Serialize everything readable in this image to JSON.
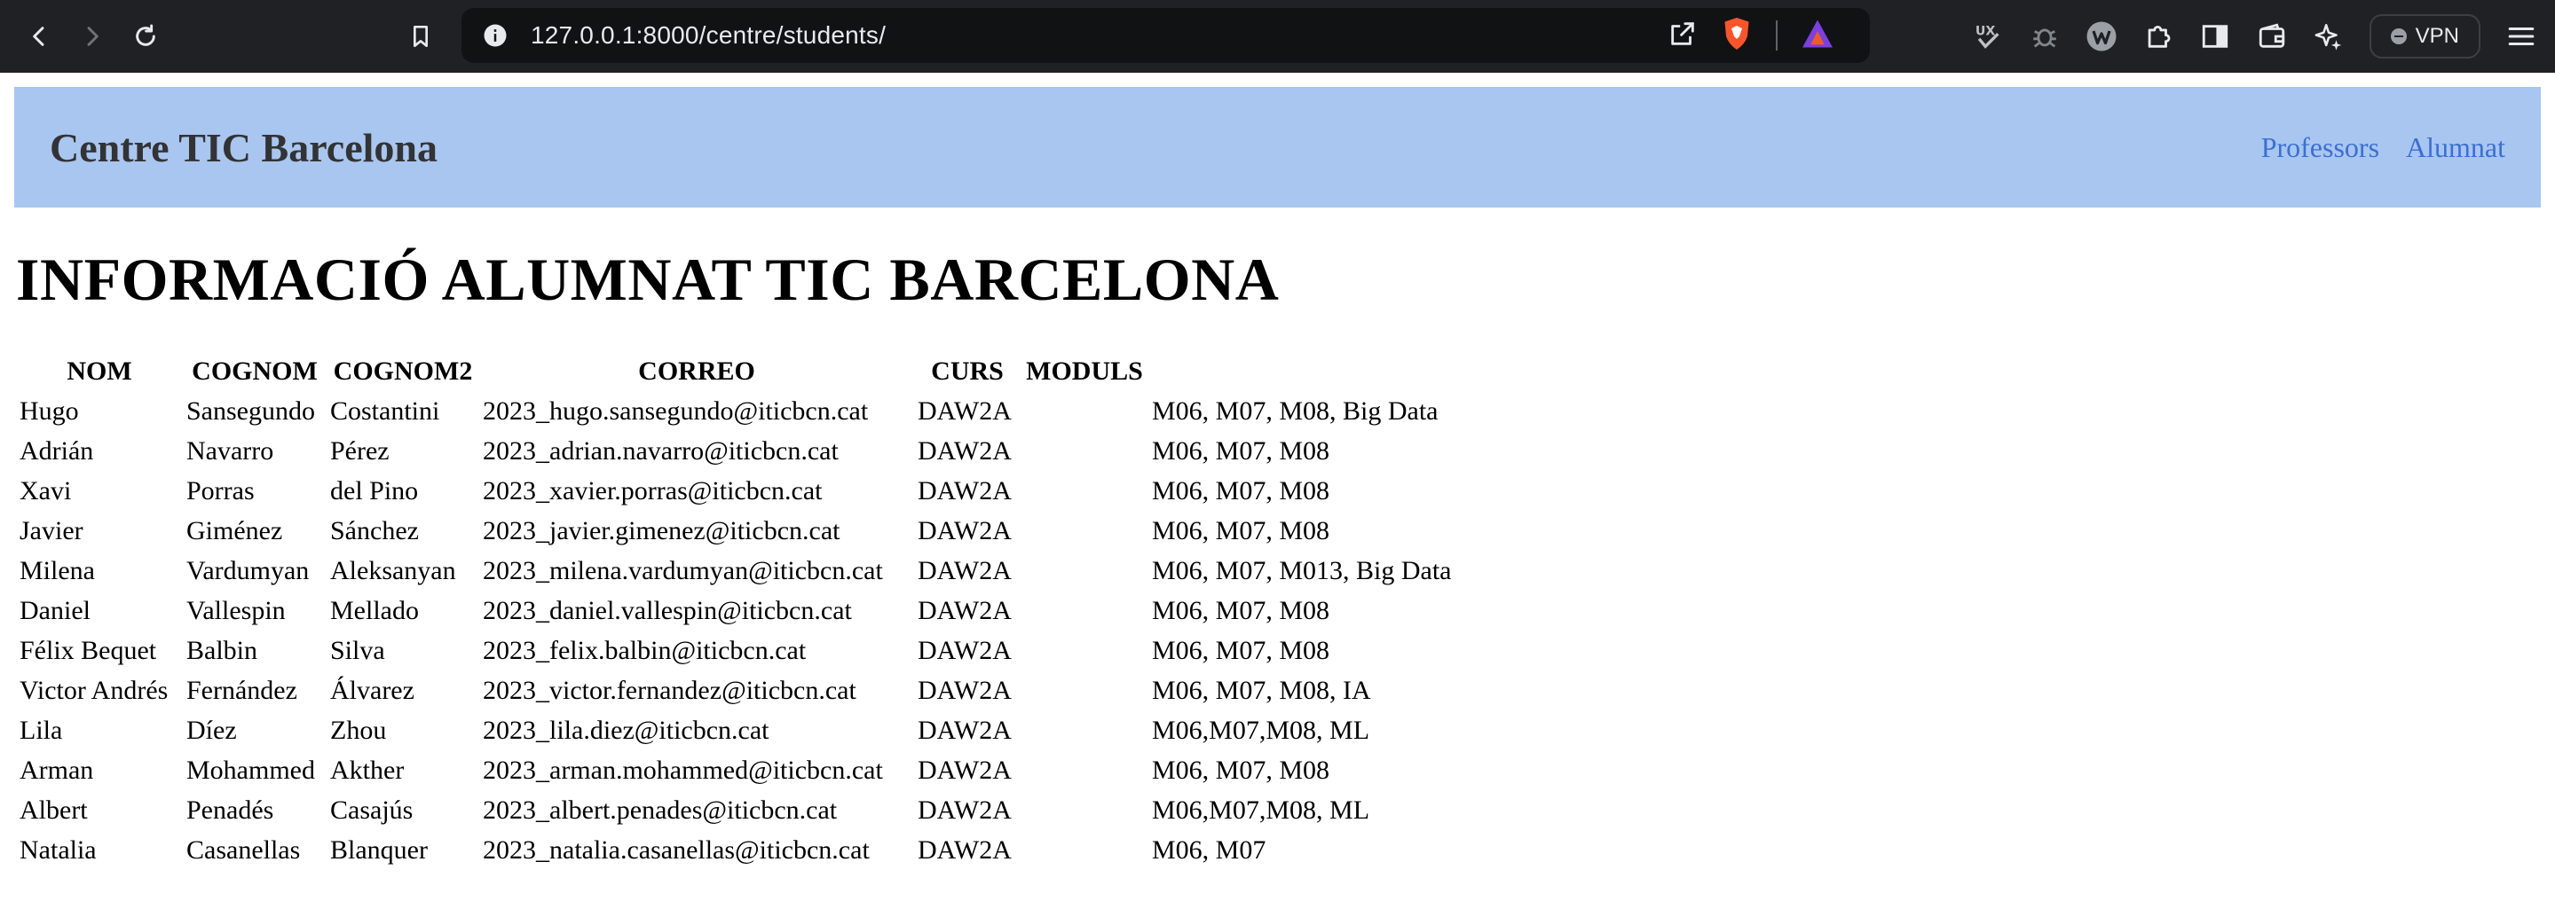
{
  "browser": {
    "url": "127.0.0.1:8000/centre/students/",
    "vpn_label": "VPN"
  },
  "header": {
    "title": "Centre TIC Barcelona",
    "nav": [
      "Professors",
      "Alumnat"
    ]
  },
  "page": {
    "heading": "INFORMACIÓ ALUMNAT TIC BARCELONA"
  },
  "table": {
    "columns": [
      "NOM",
      "COGNOM",
      "COGNOM2",
      "CORREO",
      "CURS",
      "MODULS"
    ],
    "rows": [
      [
        "Hugo",
        "Sansegundo",
        "Costantini",
        "2023_hugo.sansegundo@iticbcn.cat",
        "DAW2A",
        "M06, M07, M08, Big Data"
      ],
      [
        "Adrián",
        "Navarro",
        "Pérez",
        "2023_adrian.navarro@iticbcn.cat",
        "DAW2A",
        "M06, M07, M08"
      ],
      [
        "Xavi",
        "Porras",
        "del Pino",
        "2023_xavier.porras@iticbcn.cat",
        "DAW2A",
        "M06, M07, M08"
      ],
      [
        "Javier",
        "Giménez",
        "Sánchez",
        "2023_javier.gimenez@iticbcn.cat",
        "DAW2A",
        "M06, M07, M08"
      ],
      [
        "Milena",
        "Vardumyan",
        "Aleksanyan",
        "2023_milena.vardumyan@iticbcn.cat",
        "DAW2A",
        "M06, M07, M013, Big Data"
      ],
      [
        "Daniel",
        "Vallespin",
        "Mellado",
        "2023_daniel.vallespin@iticbcn.cat",
        "DAW2A",
        "M06, M07, M08"
      ],
      [
        "Félix Bequet",
        "Balbin",
        "Silva",
        "2023_felix.balbin@iticbcn.cat",
        "DAW2A",
        "M06, M07, M08"
      ],
      [
        "Victor Andrés",
        "Fernández",
        "Álvarez",
        "2023_victor.fernandez@iticbcn.cat",
        "DAW2A",
        "M06, M07, M08, IA"
      ],
      [
        "Lila",
        "Díez",
        "Zhou",
        "2023_lila.diez@iticbcn.cat",
        "DAW2A",
        "M06,M07,M08, ML"
      ],
      [
        "Arman",
        "Mohammed",
        "Akther",
        "2023_arman.mohammed@iticbcn.cat",
        "DAW2A",
        "M06, M07, M08"
      ],
      [
        "Albert",
        "Penadés",
        "Casajús",
        "2023_albert.penades@iticbcn.cat",
        "DAW2A",
        "M06,M07,M08, ML"
      ],
      [
        "Natalia",
        "Casanellas",
        "Blanquer",
        "2023_natalia.casanellas@iticbcn.cat",
        "DAW2A",
        "M06, M07"
      ]
    ]
  }
}
